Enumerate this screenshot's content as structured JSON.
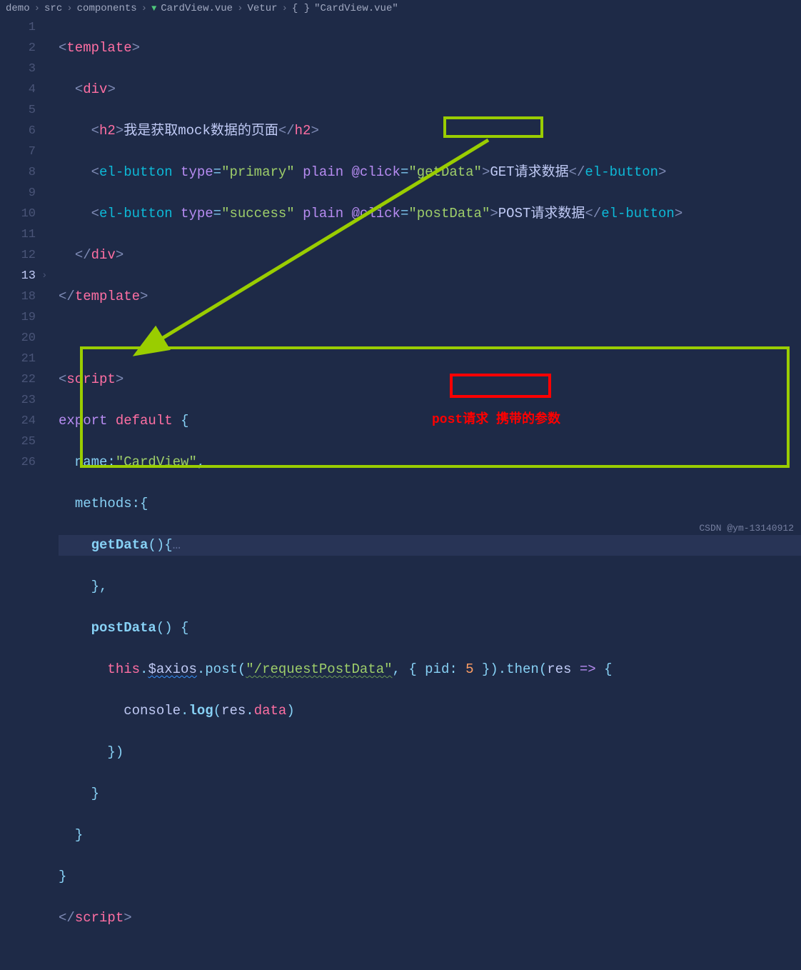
{
  "breadcrumb": {
    "p0": "demo",
    "p1": "src",
    "p2": "components",
    "p3": "CardView.vue",
    "p4": "Vetur",
    "p5": "\"CardView.vue\""
  },
  "lineNumbers": [
    "1",
    "2",
    "3",
    "4",
    "5",
    "6",
    "7",
    "8",
    "9",
    "10",
    "11",
    "12",
    "13",
    "18",
    "19",
    "20",
    "21",
    "22",
    "23",
    "24",
    "25",
    "26"
  ],
  "code": {
    "templateOpen": "template",
    "divOpen": "div",
    "h2Open": "h2",
    "h2Text": "我是获取mock数据的页面",
    "h2Close": "h2",
    "elButton": "el-button",
    "attrType": "type",
    "valPrimary": "\"primary\"",
    "valSuccess": "\"success\"",
    "attrPlain": "plain",
    "attrClick": "@click",
    "valGetData": "\"getData\"",
    "valPostData": "\"postData\"",
    "btnTextGet": "GET请求数据",
    "btnTextPost": "POST请求数据",
    "divClose": "div",
    "templateClose": "template",
    "scriptOpen": "script",
    "export": "export",
    "default": "default",
    "nameAttr": "name",
    "nameVal": "\"CardView\"",
    "methods": "methods",
    "getDataFn": "getData",
    "collapsedDots": "…",
    "postDataFn": "postData",
    "thisKw": "this",
    "axios": "$axios",
    "post": "post",
    "url": "\"/requestPostData\"",
    "pid": "pid",
    "pidVal": "5",
    "then": "then",
    "res": "res",
    "arrow": "=>",
    "console": "console",
    "log": "log",
    "data": "data",
    "scriptClose": "script"
  },
  "annotation": "post请求 携带的参数",
  "watermark": "CSDN @ym-13140912"
}
